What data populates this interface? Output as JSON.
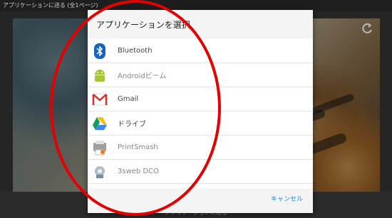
{
  "window": {
    "title": "アプリケーションに送る (全1ページ)"
  },
  "background": {
    "bottom_label": "アプリケーションに送る"
  },
  "dialog": {
    "title": "アプリケーションを選択",
    "cancel_label": "キャンセル",
    "items": [
      {
        "label": "Bluetooth",
        "icon": "bluetooth-icon"
      },
      {
        "label": "Androidビーム",
        "icon": "android-beam-icon"
      },
      {
        "label": "Gmail",
        "icon": "gmail-icon"
      },
      {
        "label": "ドライブ",
        "icon": "drive-icon"
      },
      {
        "label": "PrintSmash",
        "icon": "printsmash-icon"
      },
      {
        "label": "3sweb DCO",
        "icon": "sweb-icon"
      }
    ]
  },
  "colors": {
    "accent": "#1a8fd6",
    "annotation": "#e30000"
  }
}
